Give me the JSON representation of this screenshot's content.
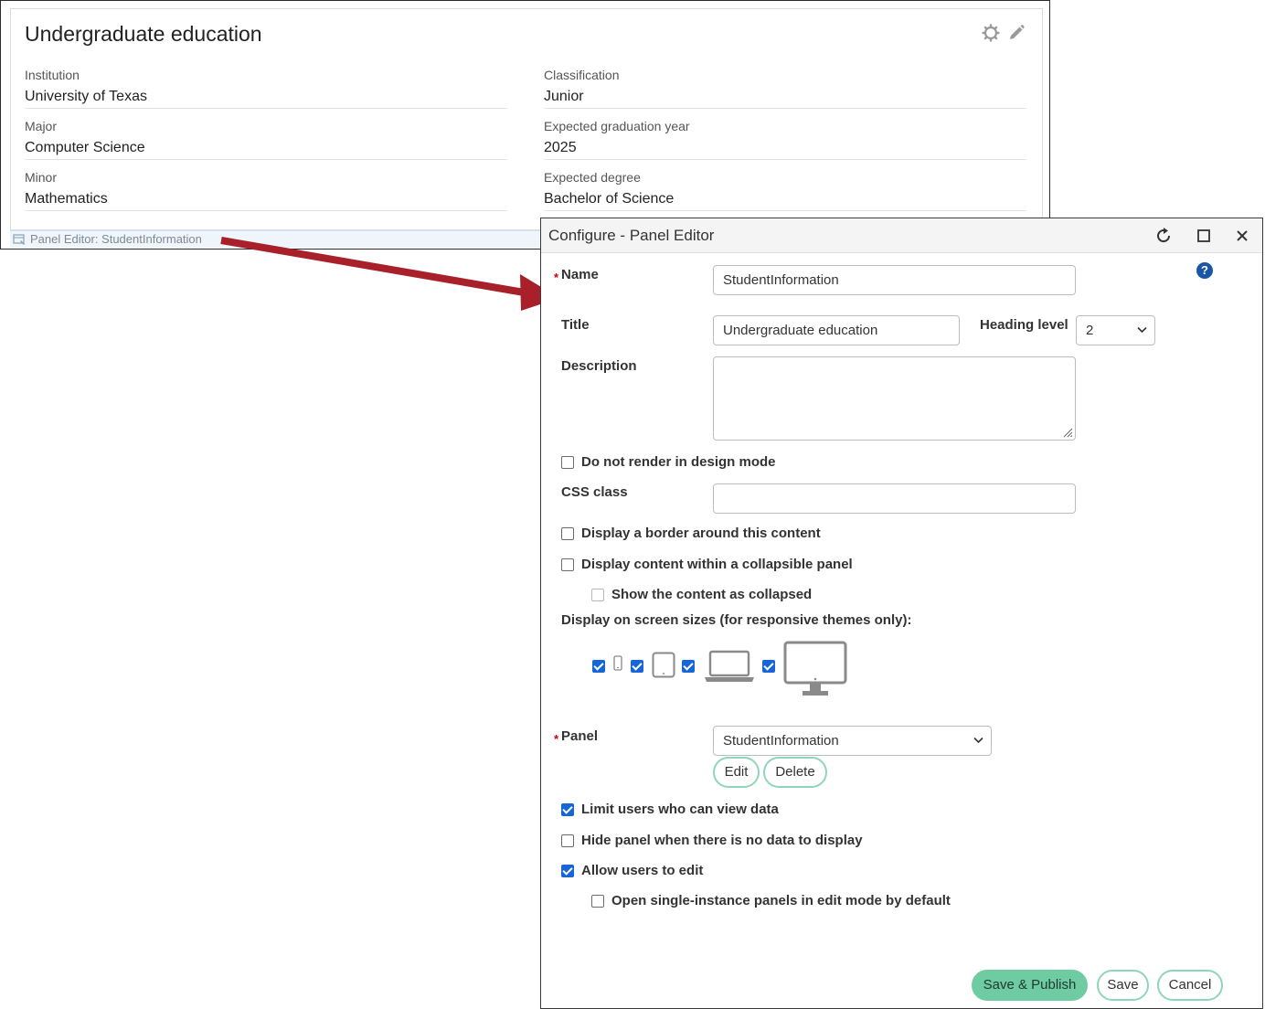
{
  "panel": {
    "title": "Undergraduate education",
    "fields_left": [
      {
        "label": "Institution",
        "value": "University of Texas"
      },
      {
        "label": "Major",
        "value": "Computer Science"
      },
      {
        "label": "Minor",
        "value": "Mathematics"
      }
    ],
    "fields_right": [
      {
        "label": "Classification",
        "value": "Junior"
      },
      {
        "label": "Expected graduation year",
        "value": "2025"
      },
      {
        "label": "Expected degree",
        "value": "Bachelor of Science"
      }
    ],
    "footer_label": "Panel Editor: StudentInformation"
  },
  "dialog": {
    "title": "Configure - Panel Editor",
    "help_label": "?",
    "name_label": "Name",
    "name_value": "StudentInformation",
    "title_label": "Title",
    "title_value": "Undergraduate education",
    "heading_label": "Heading level",
    "heading_value": "2",
    "description_label": "Description",
    "do_not_render_label": "Do not render in design mode",
    "css_label": "CSS class",
    "border_label": "Display a border around this content",
    "collapsible_label": "Display content within a collapsible panel",
    "collapsed_label": "Show the content as collapsed",
    "screen_sizes_label": "Display on screen sizes (for responsive themes only):",
    "panel_label": "Panel",
    "panel_value": "StudentInformation",
    "edit_label": "Edit",
    "delete_label": "Delete",
    "limit_label": "Limit users who can view data",
    "hide_label": "Hide panel when there is no data to display",
    "allow_edit_label": "Allow users to edit",
    "single_instance_label": "Open single-instance panels in edit mode by default",
    "save_publish_label": "Save & Publish",
    "save_label": "Save",
    "cancel_label": "Cancel"
  },
  "colors": {
    "primary_button": "#6fcba1",
    "button_border": "#8fd6b8",
    "checkbox": "#1866d6",
    "arrow": "#a8202a",
    "required": "#d40000"
  }
}
